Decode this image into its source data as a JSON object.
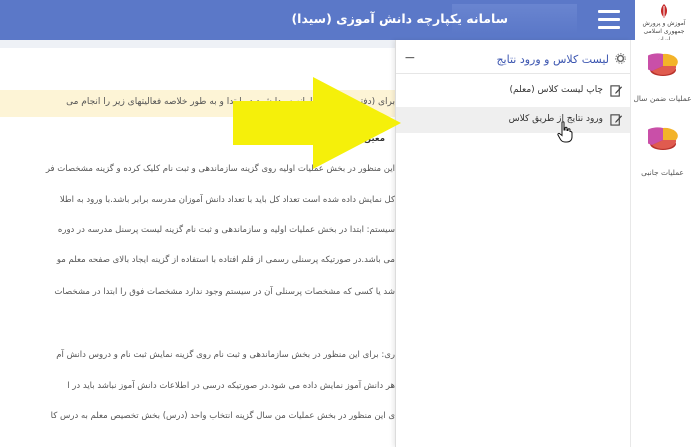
{
  "header": {
    "app_title": "سامانه یکپارچه دانش آموزی  (سیدا)",
    "logo_text": "آموزش و پرورش\nجمهوری اسلامی ایران"
  },
  "panel": {
    "title": "لیست کلاس و ورود نتایج",
    "collapse_symbol": "−",
    "items": [
      {
        "label": "چاپ لیست کلاس (معلم)"
      },
      {
        "label": "ورود نتایج از طریق کلاس"
      }
    ]
  },
  "sidebar": {
    "items": [
      {
        "label": "عملیات ضمن سال"
      },
      {
        "label": "عملیات جانبی"
      }
    ]
  },
  "content": {
    "note": "برای (دفتردار) وارد سامانه سیدا شود در ابتدا و به طور خلاصه فعالیتهای زیر را انجام می",
    "lines": [
      "معین :",
      "این منظور در بخش عملیات اولیه روی گزینه سازماندهی و ثبت نام کلیک کرده و گزینه مشخصات فر",
      "کل نمایش داده شده است تعداد کل باید با تعداد دانش آموزان مدرسه برابر باشد.با ورود به اطلا",
      "سیستم: ابتدا در بخش عملیات اولیه و سازماندهی و ثبت نام گزینه لیست پرسنل مدرسه در دوره",
      "می باشد.در صورتیکه پرسنلی رسمی از قلم افتاده با استفاده از گزینه ایجاد بالای صفحه معلم مو",
      "شد یا کسی که مشخصات پرسنلی آن در سیستم وجود ندارد مشخصات فوق را ابتدا در مشخصات",
      "ری: برای این منظور در بخش سازماندهی و ثبت نام روی گزینه نمایش ثبت نام و دروس دانش آم",
      "هر دانش آموز نمایش داده می شود.در صورتیکه درسی در اطلاعات دانش آموز نباشد باید در ا",
      "ی این منظور در بخش عملیات من سال گزینه انتخاب واحد (درس) بخش تخصیص معلم به درس کا"
    ]
  },
  "colors": {
    "header_bg": "#5b78c8",
    "note_bg": "#fdf4d6",
    "arrow": "#f5f00a",
    "panel_title": "#3b55b0"
  },
  "icons": {
    "menu": "hamburger-icon",
    "gear": "gear-icon",
    "edit": "edit-icon",
    "pie": "pie-chart-icon",
    "pointer": "hand-pointer-icon"
  }
}
